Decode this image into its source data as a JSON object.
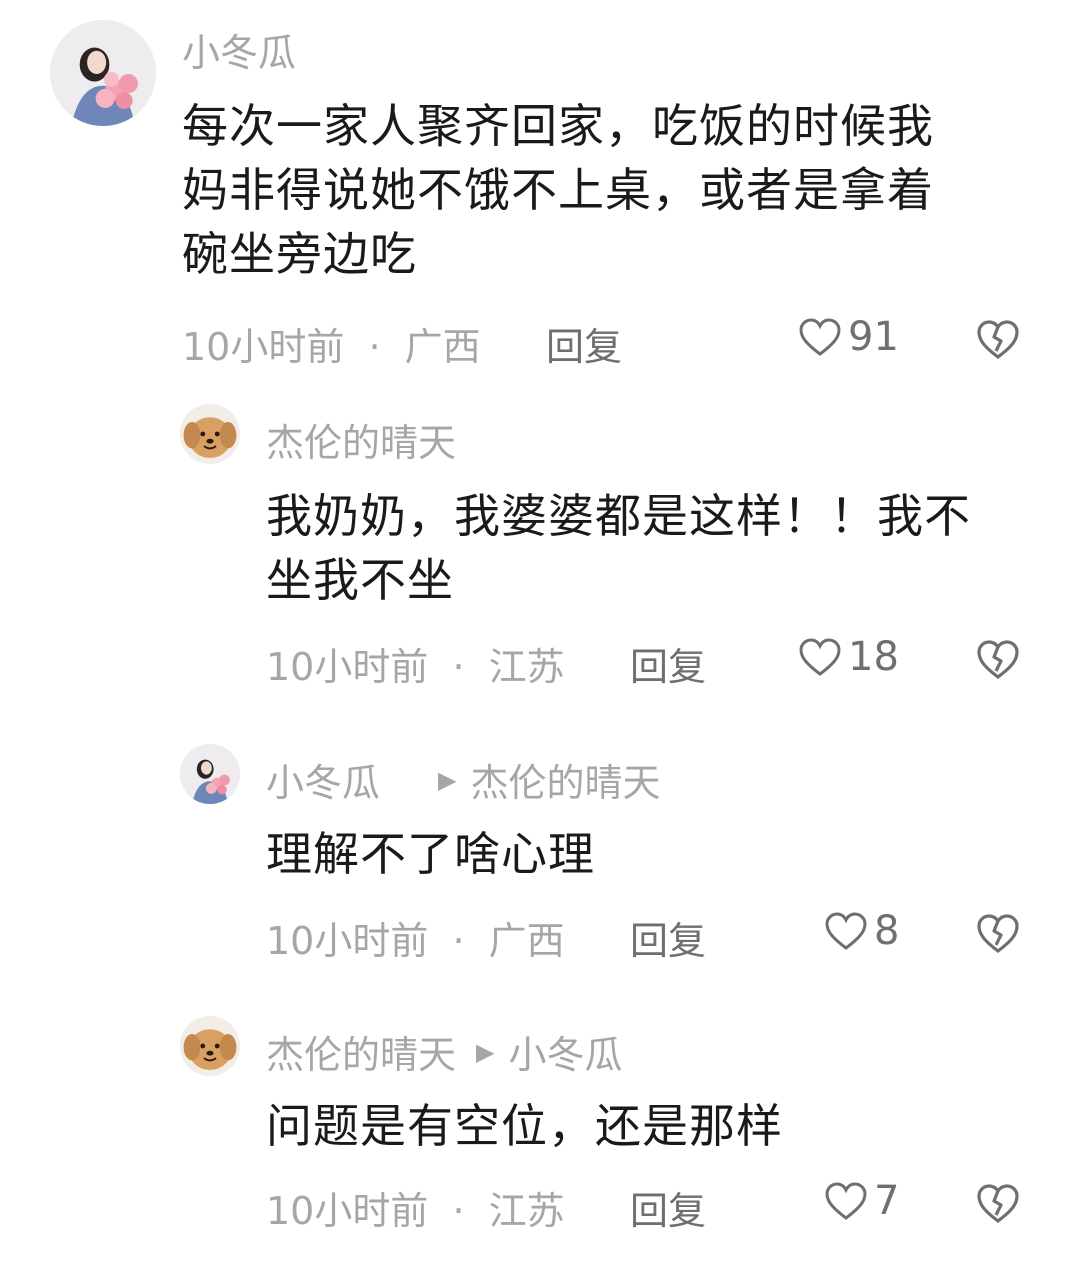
{
  "comments": [
    {
      "user": "小冬瓜",
      "text_lines": [
        "每次一家人聚齐回家，吃饭的时候我",
        "妈非得说她不饿不上桌，或者是拿着",
        "碗坐旁边吃"
      ],
      "time": "10小时前",
      "location": "广西",
      "reply_label": "回复",
      "likes": "91",
      "avatar": "girl-with-flowers-avatar"
    },
    {
      "user": "杰伦的晴天",
      "text_lines": [
        "我奶奶，我婆婆都是这样！！我不",
        "坐我不坐"
      ],
      "time": "10小时前",
      "location": "江苏",
      "reply_label": "回复",
      "likes": "18",
      "avatar": "puppy-avatar"
    },
    {
      "user": "小冬瓜",
      "reply_to": "杰伦的晴天",
      "text_lines": [
        "理解不了啥心理"
      ],
      "time": "10小时前",
      "location": "广西",
      "reply_label": "回复",
      "likes": "8",
      "avatar": "girl-with-flowers-avatar"
    },
    {
      "user": "杰伦的晴天",
      "reply_to": "小冬瓜",
      "text_lines": [
        "问题是有空位，还是那样"
      ],
      "time": "10小时前",
      "location": "江苏",
      "reply_label": "回复",
      "likes": "7",
      "avatar": "puppy-avatar"
    }
  ],
  "separator": "·",
  "colors": {
    "text_primary": "#1a1a1a",
    "text_secondary": "#a6a6aa",
    "action": "#6e6e73",
    "background": "#ffffff"
  }
}
